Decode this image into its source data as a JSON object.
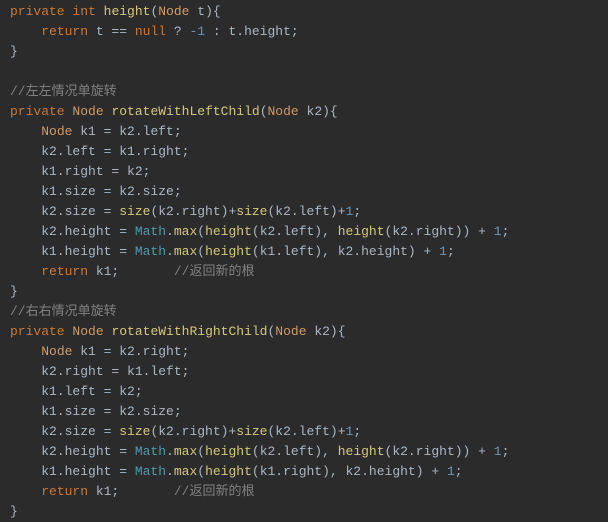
{
  "code": {
    "l1": "private int height(Node t){",
    "l2": "    return t == null ? -1 : t.height;",
    "l3": "}",
    "l4": "",
    "l5": "//左左情况单旋转",
    "l6": "private Node rotateWithLeftChild(Node k2){",
    "l7": "    Node k1 = k2.left;",
    "l8": "    k2.left = k1.right;",
    "l9": "    k1.right = k2;",
    "l10": "    k1.size = k2.size;",
    "l11": "    k2.size = size(k2.right)+size(k2.left)+1;",
    "l12": "    k2.height = Math.max(height(k2.left), height(k2.right)) + 1;",
    "l13": "    k1.height = Math.max(height(k1.left), k2.height) + 1;",
    "l14": "    return k1;       //返回新的根",
    "l15": "}",
    "l16": "//右右情况单旋转",
    "l17": "private Node rotateWithRightChild(Node k2){",
    "l18": "    Node k1 = k2.right;",
    "l19": "    k2.right = k1.left;",
    "l20": "    k1.left = k2;",
    "l21": "    k1.size = k2.size;",
    "l22": "    k2.size = size(k2.right)+size(k2.left)+1;",
    "l23": "    k2.height = Math.max(height(k2.left), height(k2.right)) + 1;",
    "l24": "    k1.height = Math.max(height(k1.right), k2.height) + 1;",
    "l25": "    return k1;       //返回新的根",
    "l26": "}"
  },
  "tokens": {
    "private": "private",
    "int": "int",
    "return": "return",
    "null": "null",
    "Node": "Node",
    "Math": "Math",
    "neg1": "-1",
    "one": "1",
    "height": "height",
    "rotateWithLeftChild": "rotateWithLeftChild",
    "rotateWithRightChild": "rotateWithRightChild",
    "size": "size",
    "max": "max",
    "cmt_left": "//左左情况单旋转",
    "cmt_right": "//右右情况单旋转",
    "cmt_retroot": "//返回新的根"
  }
}
